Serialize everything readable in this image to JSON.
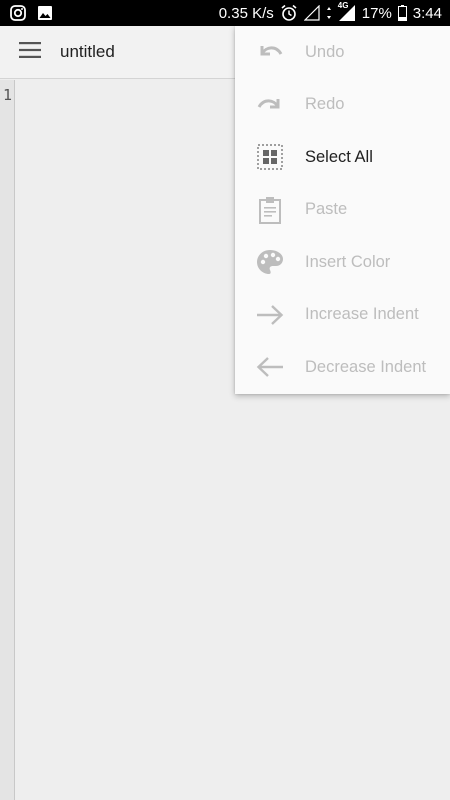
{
  "status_bar": {
    "speed": "0.35 K/s",
    "network": "4G",
    "battery": "17%",
    "time": "3:44",
    "icons": [
      "instagram-icon",
      "image-icon",
      "alarm-icon",
      "signal-icon",
      "data-arrows-icon",
      "signal-4g-icon",
      "battery-icon"
    ]
  },
  "app_bar": {
    "title": "untitled",
    "menu_icon": "hamburger-icon"
  },
  "editor": {
    "line_numbers": [
      "1"
    ],
    "content": ""
  },
  "overflow_menu": {
    "items": [
      {
        "label": "Undo",
        "icon": "undo-icon",
        "enabled": false
      },
      {
        "label": "Redo",
        "icon": "redo-icon",
        "enabled": false
      },
      {
        "label": "Select All",
        "icon": "select-all-icon",
        "enabled": true
      },
      {
        "label": "Paste",
        "icon": "paste-icon",
        "enabled": false
      },
      {
        "label": "Insert Color",
        "icon": "palette-icon",
        "enabled": false
      },
      {
        "label": "Increase Indent",
        "icon": "arrow-right-icon",
        "enabled": false
      },
      {
        "label": "Decrease Indent",
        "icon": "arrow-left-icon",
        "enabled": false
      }
    ]
  },
  "colors": {
    "status_bar": "#000000",
    "app_bar": "#f2f2f2",
    "background": "#eeeeee",
    "menu_background": "#fafafa",
    "disabled_text": "#bdbdbd",
    "enabled_text": "#212121"
  }
}
